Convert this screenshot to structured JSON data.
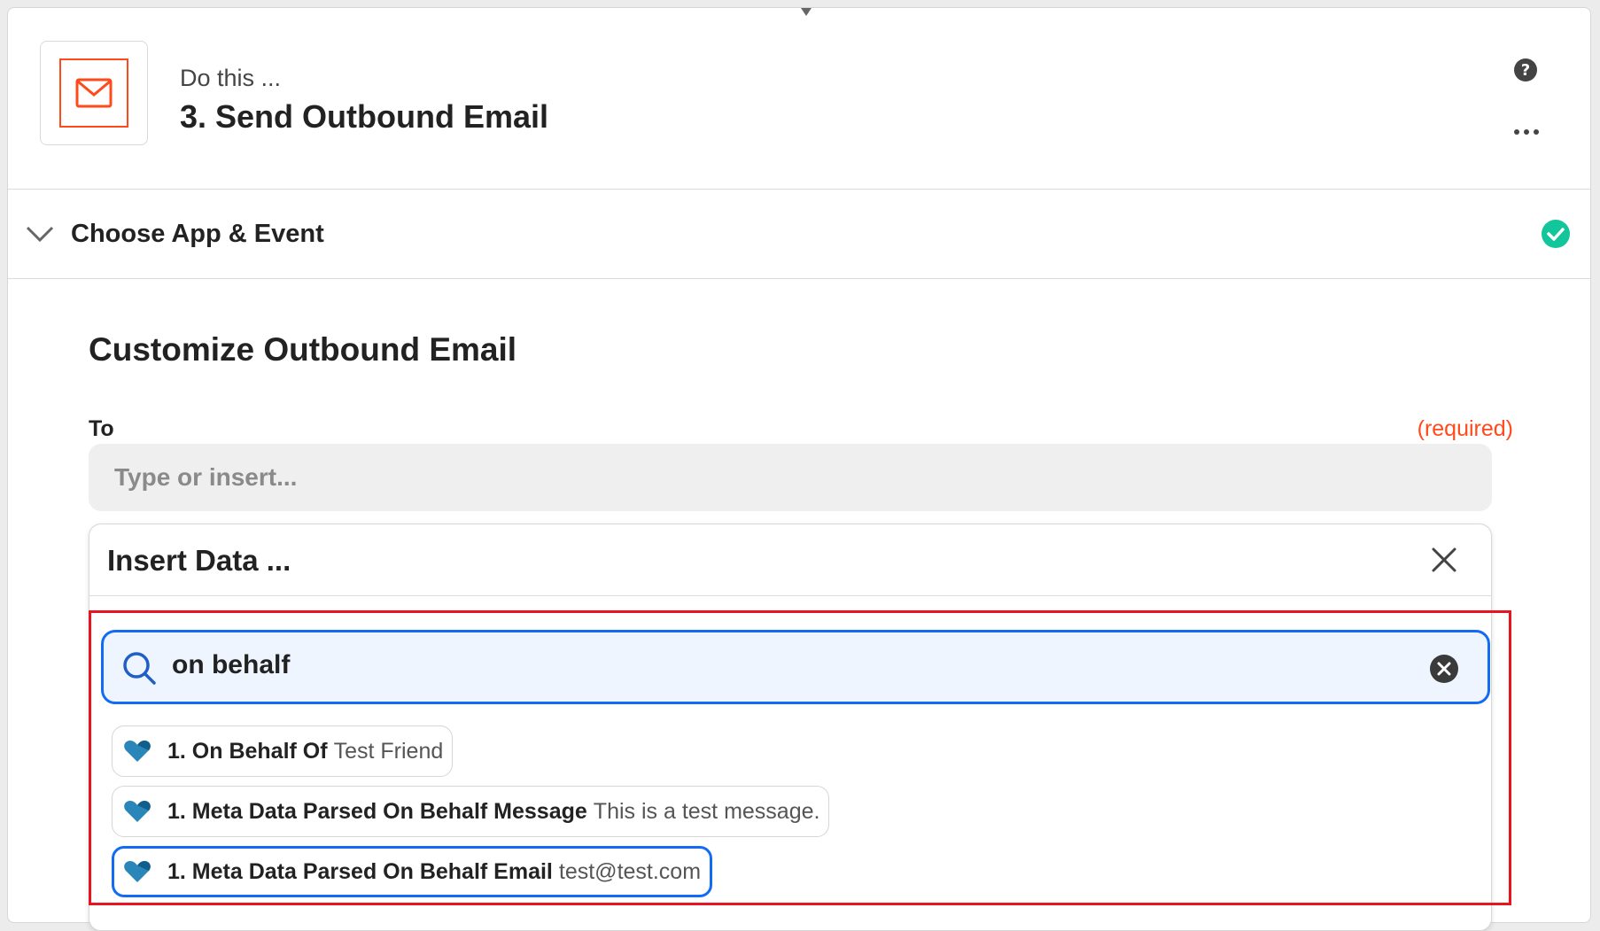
{
  "step": {
    "prefix": "Do this ...",
    "title": "3. Send Outbound Email"
  },
  "section": {
    "title": "Choose App & Event"
  },
  "form": {
    "title": "Customize Outbound Email",
    "field": {
      "label": "To",
      "required": "(required)",
      "placeholder": "Type or insert..."
    }
  },
  "insert_panel": {
    "title": "Insert Data ...",
    "search_value": "on behalf",
    "items": [
      {
        "key": "1. On Behalf Of",
        "value": "Test Friend"
      },
      {
        "key": "1. Meta Data Parsed On Behalf Message",
        "value": "This is a test message."
      },
      {
        "key": "1. Meta Data Parsed On Behalf Email",
        "value": "test@test.com"
      }
    ]
  },
  "colors": {
    "accent": "#136bf5",
    "brand": "#ff4a1c",
    "success": "#13c59b",
    "highlight": "#e8141f"
  },
  "icons": [
    "mail-icon",
    "help-icon",
    "more-icon",
    "chevron-down-icon",
    "check-circle-icon",
    "close-icon",
    "search-icon",
    "clear-icon",
    "heart-icon"
  ]
}
